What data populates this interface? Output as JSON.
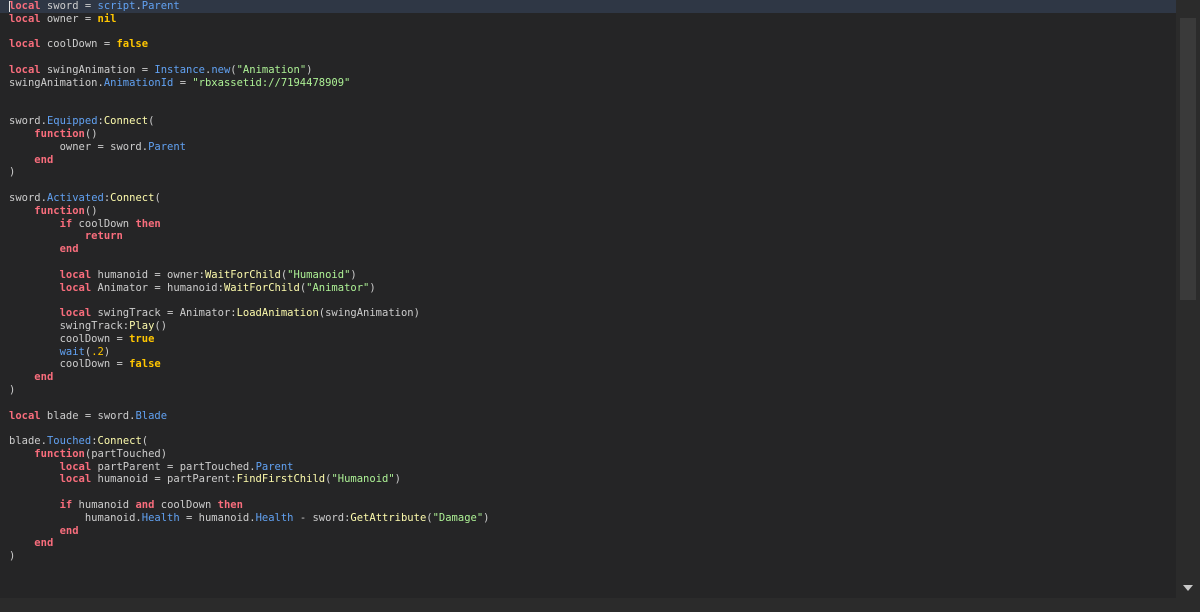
{
  "editor": {
    "background": "#252526",
    "current_line_color": "#2f3745",
    "colors": {
      "keyword": "#f86d7c",
      "boolean": "#ffc600",
      "property": "#61a1f1",
      "method": "#fdfbac",
      "string": "#adf195",
      "number": "#ffc600",
      "text": "#cccccc"
    },
    "lines": [
      [
        [
          "kw",
          "local"
        ],
        [
          "t",
          " sword = "
        ],
        [
          "p",
          "script"
        ],
        [
          "t",
          "."
        ],
        [
          "p",
          "Parent"
        ]
      ],
      [
        [
          "kw",
          "local"
        ],
        [
          "t",
          " owner = "
        ],
        [
          "b",
          "nil"
        ]
      ],
      [],
      [
        [
          "kw",
          "local"
        ],
        [
          "t",
          " coolDown = "
        ],
        [
          "b",
          "false"
        ]
      ],
      [],
      [
        [
          "kw",
          "local"
        ],
        [
          "t",
          " swingAnimation = "
        ],
        [
          "p",
          "Instance"
        ],
        [
          "t",
          "."
        ],
        [
          "p",
          "new"
        ],
        [
          "t",
          "("
        ],
        [
          "s",
          "\"Animation\""
        ],
        [
          "t",
          ")"
        ]
      ],
      [
        [
          "t",
          "swingAnimation."
        ],
        [
          "p",
          "AnimationId"
        ],
        [
          "t",
          " = "
        ],
        [
          "s",
          "\"rbxassetid://7194478909\""
        ]
      ],
      [],
      [],
      [
        [
          "t",
          "sword."
        ],
        [
          "p",
          "Equipped"
        ],
        [
          "t",
          ":"
        ],
        [
          "m",
          "Connect"
        ],
        [
          "t",
          "("
        ]
      ],
      [
        [
          "t",
          "    "
        ],
        [
          "kw",
          "function"
        ],
        [
          "t",
          "()"
        ]
      ],
      [
        [
          "t",
          "        owner = sword."
        ],
        [
          "p",
          "Parent"
        ]
      ],
      [
        [
          "t",
          "    "
        ],
        [
          "kw",
          "end"
        ]
      ],
      [
        [
          "t",
          ")"
        ]
      ],
      [],
      [
        [
          "t",
          "sword."
        ],
        [
          "p",
          "Activated"
        ],
        [
          "t",
          ":"
        ],
        [
          "m",
          "Connect"
        ],
        [
          "t",
          "("
        ]
      ],
      [
        [
          "t",
          "    "
        ],
        [
          "kw",
          "function"
        ],
        [
          "t",
          "()"
        ]
      ],
      [
        [
          "t",
          "        "
        ],
        [
          "kw",
          "if"
        ],
        [
          "t",
          " coolDown "
        ],
        [
          "kw",
          "then"
        ]
      ],
      [
        [
          "t",
          "            "
        ],
        [
          "kw",
          "return"
        ]
      ],
      [
        [
          "t",
          "        "
        ],
        [
          "kw",
          "end"
        ]
      ],
      [],
      [
        [
          "t",
          "        "
        ],
        [
          "kw",
          "local"
        ],
        [
          "t",
          " humanoid = owner:"
        ],
        [
          "m",
          "WaitForChild"
        ],
        [
          "t",
          "("
        ],
        [
          "s",
          "\"Humanoid\""
        ],
        [
          "t",
          ")"
        ]
      ],
      [
        [
          "t",
          "        "
        ],
        [
          "kw",
          "local"
        ],
        [
          "t",
          " Animator = humanoid:"
        ],
        [
          "m",
          "WaitForChild"
        ],
        [
          "t",
          "("
        ],
        [
          "s",
          "\"Animator\""
        ],
        [
          "t",
          ")"
        ]
      ],
      [],
      [
        [
          "t",
          "        "
        ],
        [
          "kw",
          "local"
        ],
        [
          "t",
          " swingTrack = Animator:"
        ],
        [
          "m",
          "LoadAnimation"
        ],
        [
          "t",
          "(swingAnimation)"
        ]
      ],
      [
        [
          "t",
          "        swingTrack:"
        ],
        [
          "m",
          "Play"
        ],
        [
          "t",
          "()"
        ]
      ],
      [
        [
          "t",
          "        coolDown = "
        ],
        [
          "b",
          "true"
        ]
      ],
      [
        [
          "t",
          "        "
        ],
        [
          "p",
          "wait"
        ],
        [
          "t",
          "("
        ],
        [
          "n",
          ".2"
        ],
        [
          "t",
          ")"
        ]
      ],
      [
        [
          "t",
          "        coolDown = "
        ],
        [
          "b",
          "false"
        ]
      ],
      [
        [
          "t",
          "    "
        ],
        [
          "kw",
          "end"
        ]
      ],
      [
        [
          "t",
          ")"
        ]
      ],
      [],
      [
        [
          "kw",
          "local"
        ],
        [
          "t",
          " blade = sword."
        ],
        [
          "p",
          "Blade"
        ]
      ],
      [],
      [
        [
          "t",
          "blade."
        ],
        [
          "p",
          "Touched"
        ],
        [
          "t",
          ":"
        ],
        [
          "m",
          "Connect"
        ],
        [
          "t",
          "("
        ]
      ],
      [
        [
          "t",
          "    "
        ],
        [
          "kw",
          "function"
        ],
        [
          "t",
          "(partTouched)"
        ]
      ],
      [
        [
          "t",
          "        "
        ],
        [
          "kw",
          "local"
        ],
        [
          "t",
          " partParent = partTouched."
        ],
        [
          "p",
          "Parent"
        ]
      ],
      [
        [
          "t",
          "        "
        ],
        [
          "kw",
          "local"
        ],
        [
          "t",
          " humanoid = partParent:"
        ],
        [
          "m",
          "FindFirstChild"
        ],
        [
          "t",
          "("
        ],
        [
          "s",
          "\"Humanoid\""
        ],
        [
          "t",
          ")"
        ]
      ],
      [],
      [
        [
          "t",
          "        "
        ],
        [
          "kw",
          "if"
        ],
        [
          "t",
          " humanoid "
        ],
        [
          "kw",
          "and"
        ],
        [
          "t",
          " coolDown "
        ],
        [
          "kw",
          "then"
        ]
      ],
      [
        [
          "t",
          "            humanoid."
        ],
        [
          "p",
          "Health"
        ],
        [
          "t",
          " = humanoid."
        ],
        [
          "p",
          "Health"
        ],
        [
          "t",
          " - sword:"
        ],
        [
          "m",
          "GetAttribute"
        ],
        [
          "t",
          "("
        ],
        [
          "s",
          "\"Damage\""
        ],
        [
          "t",
          ")"
        ]
      ],
      [
        [
          "t",
          "        "
        ],
        [
          "kw",
          "end"
        ]
      ],
      [
        [
          "t",
          "    "
        ],
        [
          "kw",
          "end"
        ]
      ],
      [
        [
          "t",
          ")"
        ]
      ]
    ]
  },
  "scrollbar": {
    "down_arrow_icon": "chevron-down-icon",
    "scroll_position": 0
  }
}
